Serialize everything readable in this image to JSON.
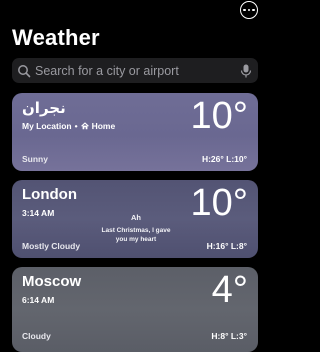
{
  "app": {
    "title": "Weather"
  },
  "search": {
    "placeholder": "Search for a city or airport",
    "value": ""
  },
  "cards": [
    {
      "city": "نجران",
      "subtitle": "My Location",
      "separator": "•",
      "home_label": "Home",
      "temperature": "10°",
      "condition": "Sunny",
      "high_low": "H:26° L:10°",
      "icon": "home-icon"
    },
    {
      "city": "London",
      "subtitle": "3:14 AM",
      "temperature": "10°",
      "condition": "Mostly Cloudy",
      "high_low": "H:16° L:8°",
      "lyrics": {
        "title": "Ah",
        "line1": "Last Christmas, I gave",
        "line2": "you my heart"
      }
    },
    {
      "city": "Moscow",
      "subtitle": "6:14 AM",
      "temperature": "4°",
      "condition": "Cloudy",
      "high_low": "H:8° L:3°"
    }
  ],
  "icons": {
    "more": "more-options-icon",
    "search": "search-icon",
    "mic": "microphone-icon",
    "home": "home-icon"
  }
}
